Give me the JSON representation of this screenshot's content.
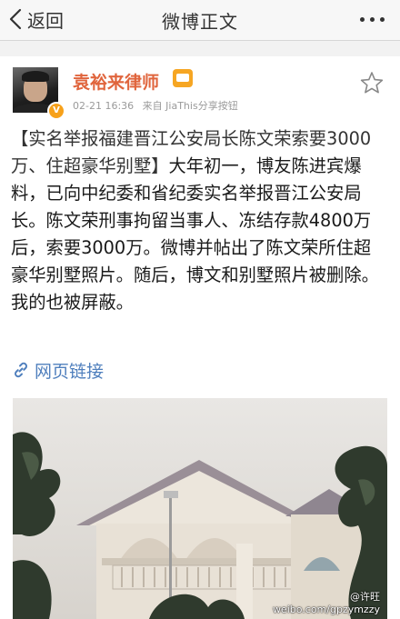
{
  "nav": {
    "back_label": "返回",
    "title": "微博正文"
  },
  "post": {
    "author": "袁裕来律师",
    "time": "02-21 16:36",
    "source_prefix": "来自",
    "source": "JiaThis分享按钮",
    "verified_badge": "V",
    "text_highlight": "【实名举报福建晋江公安局长陈文荣索要3000万、住超豪华别墅】",
    "text_body": "大年初一，博友陈进宾爆料，已向中纪委和省纪委实名举报晋江公安局长。陈文荣刑事拘留当事人、冻结存款4800万后，索要3000万。微博并帖出了陈文荣所住超豪华别墅照片。随后，博文和别墅照片被删除。我的也被屏蔽。",
    "link_label": "网页链接"
  },
  "photo": {
    "watermark_user": "@许旺",
    "watermark_url": "weibo.com/gpzymzzy"
  },
  "icons": {
    "back": "chevron-left-icon",
    "more": "more-dots-icon",
    "favorite": "star-outline-icon",
    "link": "link-icon",
    "member": "member-badge-icon"
  },
  "colors": {
    "author": "#e0653d",
    "link": "#4f7fbd",
    "verified": "#f7a11a",
    "background": "#f2f2f2"
  }
}
